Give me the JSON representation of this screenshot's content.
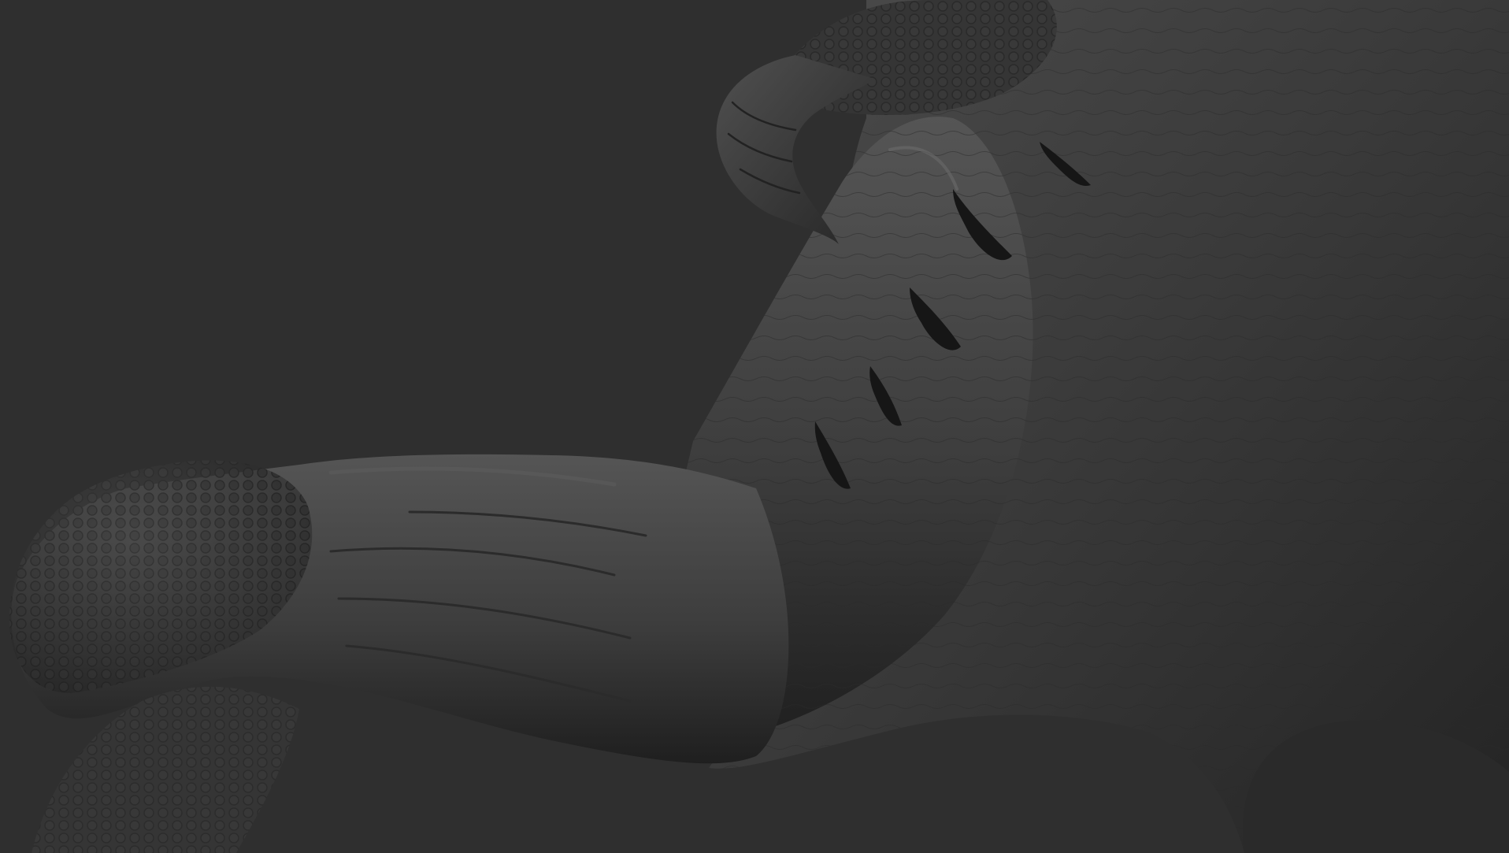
{
  "scene": {
    "subject": "sculpt-render",
    "colors": {
      "background": "#2f2f2f",
      "skin_dark": "#262626",
      "skin_mid": "#3a3a3a",
      "skin_light": "#555555",
      "slit_dark": "#161616",
      "highlight": "#6a6a6a"
    },
    "icons": [
      "horn-icon",
      "gill-slits-icon",
      "scaled-snout-icon"
    ]
  }
}
